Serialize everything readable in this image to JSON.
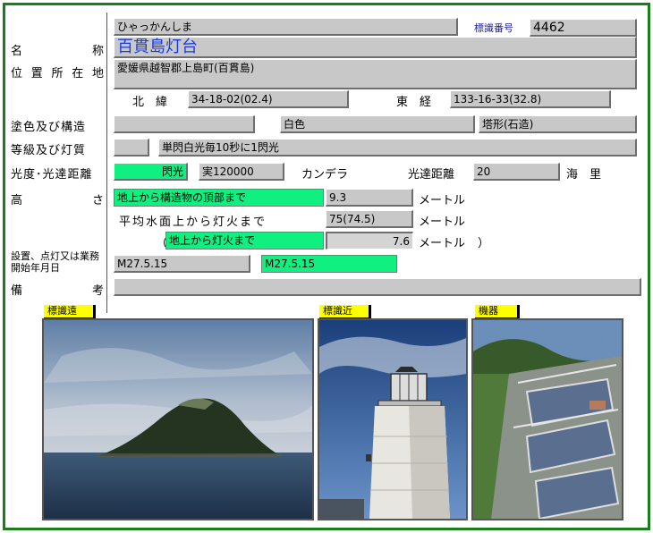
{
  "header": {
    "reading": "ひゃっかんしま",
    "id_label": "標識番号",
    "id_value": "4462",
    "name": "百貫島灯台"
  },
  "labels": {
    "name": [
      "名",
      "称"
    ],
    "location": [
      "位",
      "置",
      "所",
      "在",
      "地"
    ],
    "color_structure": "塗色及び構造",
    "class_light": "等級及び灯質",
    "luminosity": "光度･光達距離",
    "height": [
      "高",
      "さ"
    ],
    "established": "設置、点灯又は業務開始年月日",
    "remarks": [
      "備",
      "考"
    ]
  },
  "location": {
    "address": "愛媛県越智郡上島町(百貫島)",
    "lat_label": "北　緯",
    "lat_value": "34-18-02(02.4)",
    "lon_label": "東　経",
    "lon_value": "133-16-33(32.8)"
  },
  "structure": {
    "blank": "",
    "color": "白色",
    "shape": "塔形(石造)"
  },
  "light": {
    "class": "",
    "character": "単閃白光毎10秒に1閃光"
  },
  "luminosity": {
    "type": "閃光",
    "intensity": "実120000",
    "unit": "カンデラ",
    "range_label": "光達距離",
    "range_value": "20",
    "range_unit": "海　里"
  },
  "height": {
    "ground_to_top_label": "地上から構造物の頂部まで",
    "ground_to_top_value": "9.3",
    "unit": "メートル",
    "sea_to_light_label": "平均水面上から灯火まで",
    "sea_to_light_value": "75(74.5)",
    "paren_open": "（",
    "ground_to_light_label": "地上から灯火まで",
    "ground_to_light_value": "7.6",
    "paren_close": "）"
  },
  "established": {
    "date1": "M27.5.15",
    "date2": "M27.5.15"
  },
  "remarks": {
    "value": ""
  },
  "photos": [
    {
      "tag": "標識遠"
    },
    {
      "tag": "標識近"
    },
    {
      "tag": "機器"
    }
  ],
  "colors": {
    "frame": "#1a7f1a",
    "highlight": "#10f080",
    "field": "#c8c8c8",
    "tag": "#ffff00"
  }
}
